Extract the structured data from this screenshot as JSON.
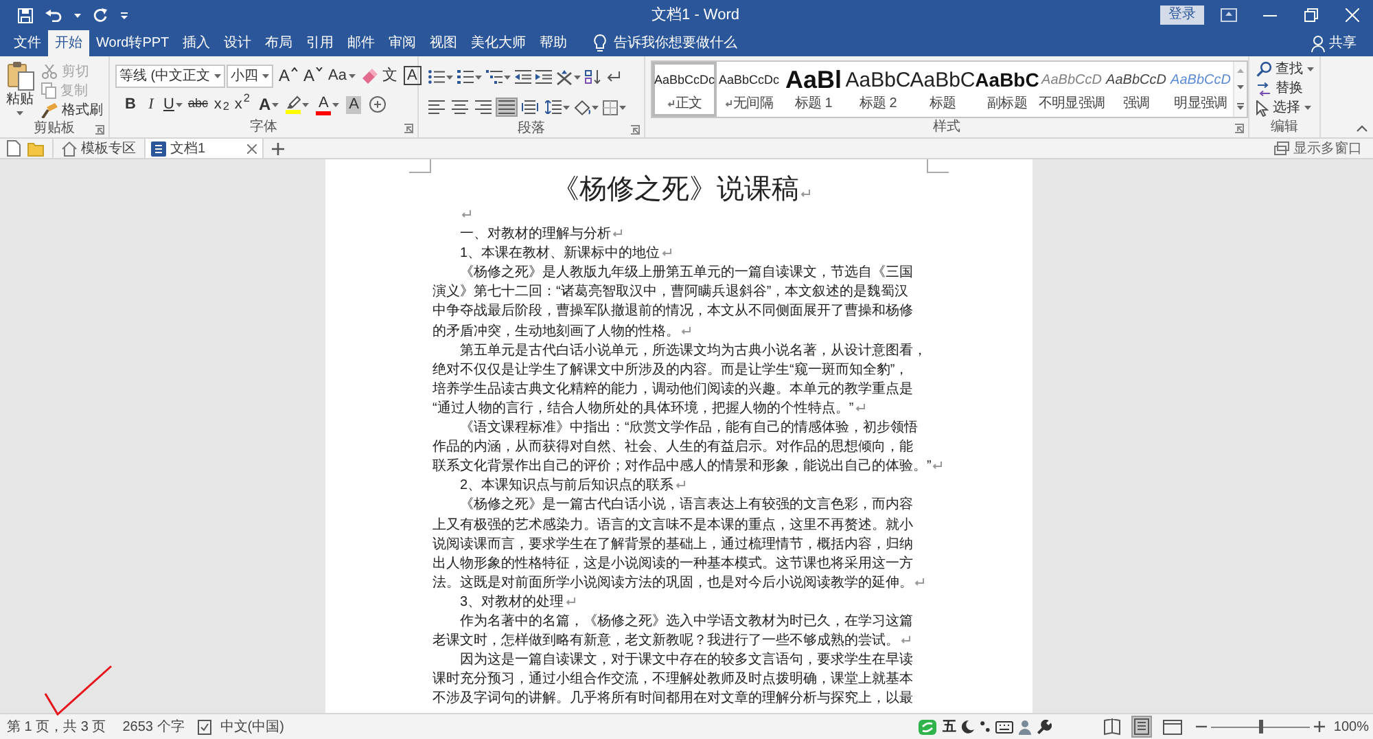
{
  "title_bar": {
    "title": "文档1 - Word",
    "sign_in": "登录"
  },
  "tabs": [
    {
      "label": "文件",
      "selected": false
    },
    {
      "label": "开始",
      "selected": true
    },
    {
      "label": "Word转PPT",
      "selected": false
    },
    {
      "label": "插入",
      "selected": false
    },
    {
      "label": "设计",
      "selected": false
    },
    {
      "label": "布局",
      "selected": false
    },
    {
      "label": "引用",
      "selected": false
    },
    {
      "label": "邮件",
      "selected": false
    },
    {
      "label": "审阅",
      "selected": false
    },
    {
      "label": "视图",
      "selected": false
    },
    {
      "label": "美化大师",
      "selected": false
    },
    {
      "label": "帮助",
      "selected": false
    }
  ],
  "tell_me": "告诉我你想要做什么",
  "share": "共享",
  "clipboard": {
    "label": "剪贴板",
    "paste": "粘贴",
    "tools": [
      {
        "kind": "cut",
        "label": "剪切",
        "disabled": true
      },
      {
        "kind": "copy",
        "label": "复制",
        "disabled": true
      },
      {
        "kind": "painter",
        "label": "格式刷",
        "disabled": false
      }
    ]
  },
  "font": {
    "label": "字体",
    "name": "等线 (中文正文",
    "size": "小四",
    "row_1": [
      {
        "kind": "grow",
        "text": "A"
      },
      {
        "kind": "shrink",
        "text": "A"
      },
      {
        "kind": "case",
        "text": "Aa",
        "dropdown": true
      },
      {
        "kind": "clear"
      },
      {
        "kind": "phonetic",
        "text": "文"
      },
      {
        "kind": "border",
        "text": "A"
      }
    ],
    "row_2": [
      {
        "kind": "bold",
        "text": "B"
      },
      {
        "kind": "italic",
        "text": "I"
      },
      {
        "kind": "underline",
        "text": "U",
        "dropdown": true
      },
      {
        "kind": "strike",
        "text": "abc"
      },
      {
        "kind": "subscript",
        "text": "x$_{2}$"
      },
      {
        "kind": "superscript",
        "text": "x$^{2}$"
      },
      {
        "kind": "effects",
        "text": "A",
        "dropdown": true
      },
      {
        "kind": "highlight",
        "dropdown": true,
        "color": "#ffff00"
      },
      {
        "kind": "color",
        "text": "A",
        "dropdown": true,
        "color": "#ff0000"
      },
      {
        "kind": "shading",
        "text": "A"
      },
      {
        "kind": "enclose"
      }
    ]
  },
  "paragraph": {
    "label": "段落",
    "row_1": [
      {
        "kind": "bullets",
        "dropdown": true
      },
      {
        "kind": "numbering",
        "dropdown": true
      },
      {
        "kind": "multilevel",
        "dropdown": true
      },
      {
        "kind": "outdent"
      },
      {
        "kind": "indent"
      },
      {
        "kind": "asian_layout",
        "dropdown": true
      },
      {
        "kind": "sort"
      },
      {
        "kind": "marks"
      }
    ],
    "row_2": [
      {
        "kind": "align_left",
        "selected": false
      },
      {
        "kind": "center",
        "selected": false
      },
      {
        "kind": "align_right",
        "selected": false
      },
      {
        "kind": "justify",
        "selected": true
      },
      {
        "kind": "distributed",
        "selected": false
      },
      {
        "kind": "line_spacing",
        "dropdown": true
      },
      {
        "kind": "shading",
        "dropdown": true
      },
      {
        "kind": "borders",
        "dropdown": true
      }
    ]
  },
  "styles": {
    "label": "样式",
    "items": [
      {
        "kind": "normal",
        "sample": "AaBbCcDc",
        "name": "正文",
        "paragraph_style": true,
        "selected": true
      },
      {
        "kind": "no_spacing",
        "sample": "AaBbCcDc",
        "name": "无间隔",
        "paragraph_style": true,
        "selected": false
      },
      {
        "kind": "heading1",
        "sample": "AaBl",
        "name": "标题 1",
        "selected": false
      },
      {
        "kind": "heading2",
        "sample": "AaBbC",
        "name": "标题 2",
        "selected": false
      },
      {
        "kind": "title",
        "sample": "AaBbC",
        "name": "标题",
        "selected": false
      },
      {
        "kind": "subtitle",
        "sample": "AaBbC",
        "name": "副标题",
        "selected": false
      },
      {
        "kind": "subtle_emphasis",
        "sample": "AaBbCcD",
        "name": "不明显强调",
        "selected": false
      },
      {
        "kind": "emphasis",
        "sample": "AaBbCcD",
        "name": "强调",
        "selected": false
      },
      {
        "kind": "intense_emphasis",
        "sample": "AaBbCcD",
        "name": "明显强调",
        "selected": false
      }
    ]
  },
  "editing": {
    "label": "编辑",
    "items": [
      {
        "kind": "find",
        "label": "查找",
        "dropdown": true
      },
      {
        "kind": "replace",
        "label": "替换"
      },
      {
        "kind": "select",
        "label": "选择",
        "dropdown": true
      }
    ]
  },
  "doc_bar": {
    "template_zone": "模板专区",
    "tabs": [
      {
        "label": "文档1",
        "selected": true
      }
    ],
    "multi_window": "显示多窗口"
  },
  "document": {
    "paragraphs": [
      {
        "kind": "title",
        "lines": [
          "《杨修之死》说课稿"
        ],
        "end_mark": true
      },
      {
        "kind": "empty",
        "end_mark": true
      },
      {
        "kind": "text",
        "lines": [
          "一、对教材的理解与分析"
        ],
        "end_mark": true
      },
      {
        "kind": "text",
        "lines": [
          "1、本课在教材、新课标中的地位"
        ],
        "end_mark": true
      },
      {
        "kind": "text",
        "lines": [
          "《杨修之死》是人教版九年级上册第五单元的一篇自读课文，节选自《三国",
          "演义》第七十二回：“诸葛亮智取汉中，曹阿瞒兵退斜谷”，本文叙述的是魏蜀汉",
          "中争夺战最后阶段，曹操军队撤退前的情况，本文从不同侧面展开了曹操和杨修",
          "的矛盾冲突，生动地刻画了人物的性格。"
        ],
        "end_mark": true
      },
      {
        "kind": "text",
        "lines": [
          "第五单元是古代白话小说单元，所选课文均为古典小说名著，从设计意图看，",
          "绝对不仅仅是让学生了解课文中所涉及的内容。而是让学生“窥一斑而知全豹”，",
          "培养学生品读古典文化精粹的能力，调动他们阅读的兴趣。本单元的教学重点是",
          "“通过人物的言行，结合人物所处的具体环境，把握人物的个性特点。”"
        ],
        "end_mark": true
      },
      {
        "kind": "text",
        "lines": [
          "《语文课程标准》中指出：“欣赏文学作品，能有自己的情感体验，初步领悟",
          "作品的内涵，从而获得对自然、社会、人生的有益启示。对作品的思想倾向，能",
          "联系文化背景作出自己的评价；对作品中感人的情景和形象，能说出自己的体验。”"
        ],
        "end_mark": true
      },
      {
        "kind": "text",
        "lines": [
          "2、本课知识点与前后知识点的联系"
        ],
        "end_mark": true
      },
      {
        "kind": "text",
        "lines": [
          "《杨修之死》是一篇古代白话小说，语言表达上有较强的文言色彩，而内容",
          "上又有极强的艺术感染力。语言的文言味不是本课的重点，这里不再赘述。就小",
          "说阅读课而言，要求学生在了解背景的基础上，通过梳理情节，概括内容，归纳",
          "出人物形象的性格特征，这是小说阅读的一种基本模式。这节课也将采用这一方",
          "法。这既是对前面所学小说阅读方法的巩固，也是对今后小说阅读教学的延伸。"
        ],
        "end_mark": true
      },
      {
        "kind": "text",
        "lines": [
          "3、对教材的处理"
        ],
        "end_mark": true
      },
      {
        "kind": "text",
        "lines": [
          "作为名著中的名篇，《杨修之死》选入中学语文教材为时已久，在学习这篇",
          "老课文时，怎样做到略有新意，老文新教呢？我进行了一些不够成熟的尝试。"
        ],
        "end_mark": true
      },
      {
        "kind": "text",
        "lines": [
          "因为这是一篇自读课文，对于课文中存在的较多文言语句，要求学生在早读",
          "课时充分预习，通过小组合作交流，不理解处教师及时点拨明确，课堂上就基本",
          "不涉及字词句的讲解。几乎将所有时间都用在对文章的理解分析与探究上，以最"
        ]
      }
    ]
  },
  "status_bar": {
    "page": "第 1 页，共 3 页",
    "words": "2653 个字",
    "language": "中文(中国)",
    "ime_mode": "五",
    "views": [
      {
        "kind": "read",
        "selected": false
      },
      {
        "kind": "print",
        "selected": true
      },
      {
        "kind": "web",
        "selected": false
      }
    ],
    "zoom": {
      "level": 0.5,
      "label": "100%"
    }
  }
}
